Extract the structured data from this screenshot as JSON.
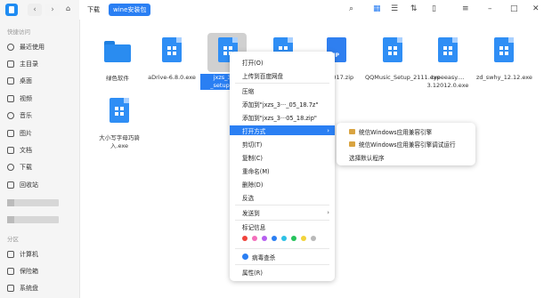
{
  "sidebar": {
    "section_quick": "快捷访问",
    "quick_items": [
      {
        "label": "最近使用",
        "icon": "clock-icon"
      },
      {
        "label": "主目录",
        "icon": "home-icon"
      },
      {
        "label": "桌面",
        "icon": "desktop-icon"
      },
      {
        "label": "视频",
        "icon": "video-icon"
      },
      {
        "label": "音乐",
        "icon": "music-icon"
      },
      {
        "label": "图片",
        "icon": "image-icon"
      },
      {
        "label": "文档",
        "icon": "document-icon"
      },
      {
        "label": "下载",
        "icon": "download-icon"
      },
      {
        "label": "回收站",
        "icon": "trash-icon"
      }
    ],
    "section_partition": "分区",
    "partition_items": [
      {
        "label": "计算机",
        "icon": "computer-icon"
      },
      {
        "label": "保险箱",
        "icon": "safe-icon"
      },
      {
        "label": "系统盘",
        "icon": "disk-icon"
      }
    ]
  },
  "topbar": {
    "back": "‹",
    "forward": "›",
    "crumbs": [
      "下载",
      "wine安装包"
    ]
  },
  "files": [
    {
      "name": "绿色软件",
      "type": "folder"
    },
    {
      "name": "aDrive-6.8.0.exe",
      "type": "exe"
    },
    {
      "name": "jxzs_3.1…_setup_…18",
      "type": "exe-selected"
    },
    {
      "name": "",
      "type": "exe"
    },
    {
      "name": "n 2017.zip",
      "type": "zip"
    },
    {
      "name": "QQMusic_Setup_2111.exe",
      "type": "exe"
    },
    {
      "name": "typeeasy.…3.12012.0.exe",
      "type": "exe"
    },
    {
      "name": "zd_swhy_12.12.exe",
      "type": "exe"
    },
    {
      "name": "大小写字母巧骑入.exe",
      "type": "exe"
    }
  ],
  "context_menu": {
    "items": [
      "打开(O)",
      "上传到百度网盘",
      "压缩",
      "添加到\"jxzs_3···_05_18.7z\"",
      "添加到\"jxzs_3···05_18.zip\"",
      "打开方式",
      "剪切(T)",
      "复制(C)",
      "重命名(M)",
      "删除(D)",
      "反选",
      "发送到",
      "标记信息",
      "病毒查杀",
      "属性(R)"
    ],
    "tag_colors": [
      "#f0433c",
      "#f36fbb",
      "#b65ff0",
      "#2a7ff3",
      "#2ec1e6",
      "#26c35c",
      "#f2d33a",
      "#b9b9b9"
    ]
  },
  "submenu": {
    "items": [
      "统信Windows应用兼容引擎",
      "统信Windows应用兼容引擎调试运行",
      "选择默认程序"
    ]
  }
}
